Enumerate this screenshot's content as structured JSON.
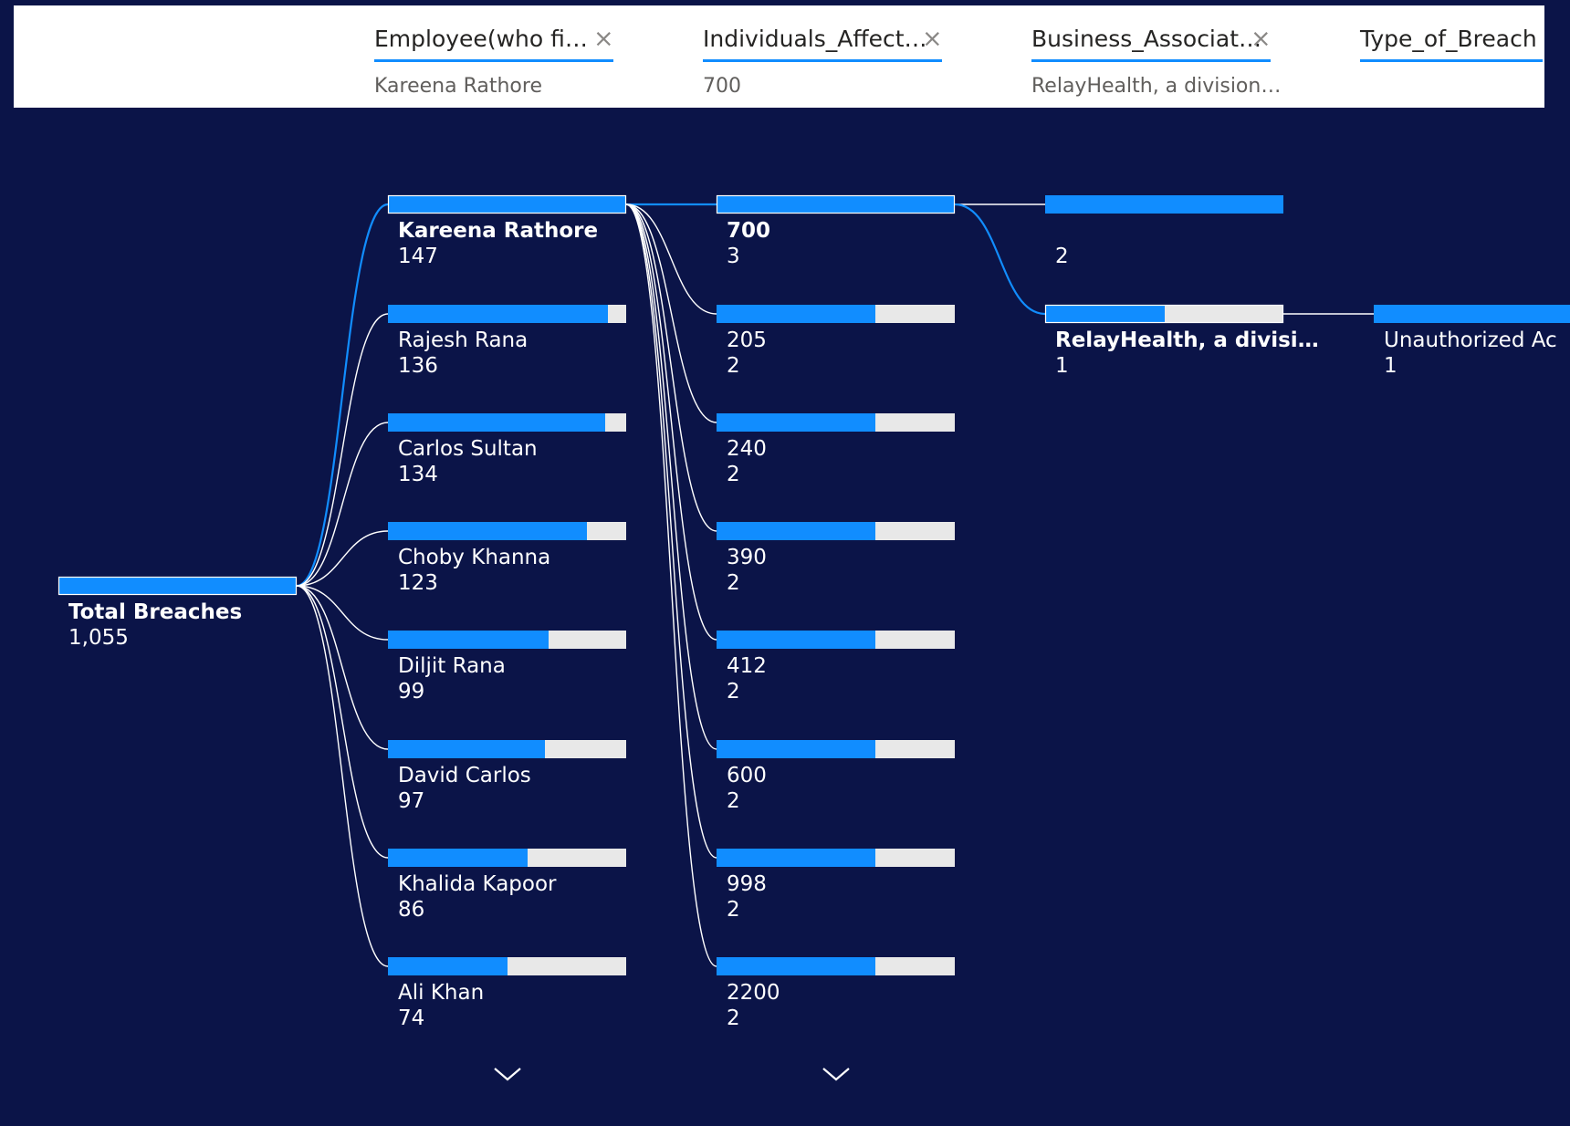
{
  "header": {
    "columns": [
      {
        "title": "Employee(who fi…",
        "value": "Kareena Rathore",
        "has_close": true
      },
      {
        "title": "Individuals_Affect…",
        "value": "700",
        "has_close": true
      },
      {
        "title": "Business_Associat…",
        "value": "RelayHealth, a division…",
        "has_close": true
      },
      {
        "title": "Type_of_Breach",
        "value": "",
        "has_close": false
      }
    ]
  },
  "colors": {
    "background": "#0b1448",
    "bar_fill": "#118dff",
    "bar_track": "#e8e8e8",
    "link": "#ffffff",
    "link_selected": "#118dff"
  },
  "tree": {
    "root": {
      "label": "Total Breaches",
      "value": "1,055"
    },
    "levels": [
      {
        "name": "Employee(who fi…",
        "nodes": [
          {
            "label": "Kareena Rathore",
            "value": "147",
            "fill": 1.0,
            "selected": true
          },
          {
            "label": "Rajesh Rana",
            "value": "136",
            "fill": 0.925
          },
          {
            "label": "Carlos Sultan",
            "value": "134",
            "fill": 0.912
          },
          {
            "label": "Choby Khanna",
            "value": "123",
            "fill": 0.837
          },
          {
            "label": "Diljit Rana",
            "value": "99",
            "fill": 0.673
          },
          {
            "label": "David Carlos",
            "value": "97",
            "fill": 0.66
          },
          {
            "label": "Khalida Kapoor",
            "value": "86",
            "fill": 0.585
          },
          {
            "label": "Ali Khan",
            "value": "74",
            "fill": 0.503
          }
        ],
        "more_icon": "chevron-down-icon"
      },
      {
        "name": "Individuals_Affect…",
        "nodes": [
          {
            "label": "700",
            "value": "3",
            "fill": 1.0,
            "selected": true
          },
          {
            "label": "205",
            "value": "2",
            "fill": 0.667
          },
          {
            "label": "240",
            "value": "2",
            "fill": 0.667
          },
          {
            "label": "390",
            "value": "2",
            "fill": 0.667
          },
          {
            "label": "412",
            "value": "2",
            "fill": 0.667
          },
          {
            "label": "600",
            "value": "2",
            "fill": 0.667
          },
          {
            "label": "998",
            "value": "2",
            "fill": 0.667
          },
          {
            "label": "2200",
            "value": "2",
            "fill": 0.667
          }
        ],
        "more_icon": "chevron-down-icon"
      },
      {
        "name": "Business_Associat…",
        "nodes": [
          {
            "label": "",
            "value": "2",
            "fill": 1.0
          },
          {
            "label": "RelayHealth, a divisi…",
            "value": "1",
            "fill": 0.5,
            "selected": true
          }
        ]
      },
      {
        "name": "Type_of_Breach",
        "nodes": [
          {
            "label": "Unauthorized Ac",
            "value": "1",
            "fill": 1.0
          }
        ]
      }
    ]
  }
}
